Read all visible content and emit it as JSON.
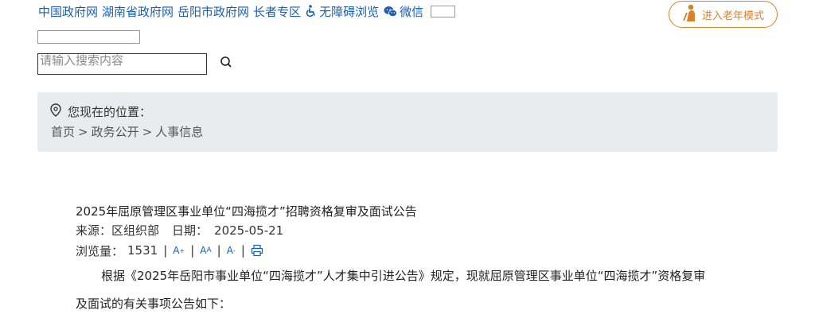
{
  "topnav": {
    "links": [
      "中国政府网",
      "湖南省政府网",
      "岳阳市政府网",
      "长者专区"
    ],
    "accessibility_label": "无障碍浏览",
    "wechat_label": "微信",
    "accessibility_icon": "wheelchair-icon",
    "wechat_icon": "wechat-icon"
  },
  "elder_mode": {
    "label": "进入老年模式",
    "icon": "elder-person-icon",
    "color": "#d9822b"
  },
  "search": {
    "placeholder": "请输入搜索内容",
    "value": "",
    "icon": "search-icon"
  },
  "location": {
    "label": "您现在的位置：",
    "icon": "location-pin-icon",
    "breadcrumbs": [
      "首页",
      "政务公开",
      "人事信息"
    ],
    "separator": ">"
  },
  "article": {
    "title": "2025年屈原管理区事业单位“四海揽才”招聘资格复审及面试公告",
    "source_label": "来源：",
    "source": "区组织部",
    "date_label": "日期：",
    "date": "2025-05-21",
    "views_label": "浏览量：",
    "views": "1531",
    "tools": [
      "font-increase-icon",
      "font-default-icon",
      "font-decrease-icon",
      "print-icon"
    ],
    "paragraph_line1": "根据《2025年岳阳市事业单位“四海揽才”人才集中引进公告》规定，现就屈原管理区事业单位“四海揽才”资格复审",
    "paragraph_line2": "及面试的有关事项公告如下："
  },
  "colors": {
    "link": "#1a5fb4",
    "accent": "#d9822b",
    "panel": "#e9ecef"
  }
}
